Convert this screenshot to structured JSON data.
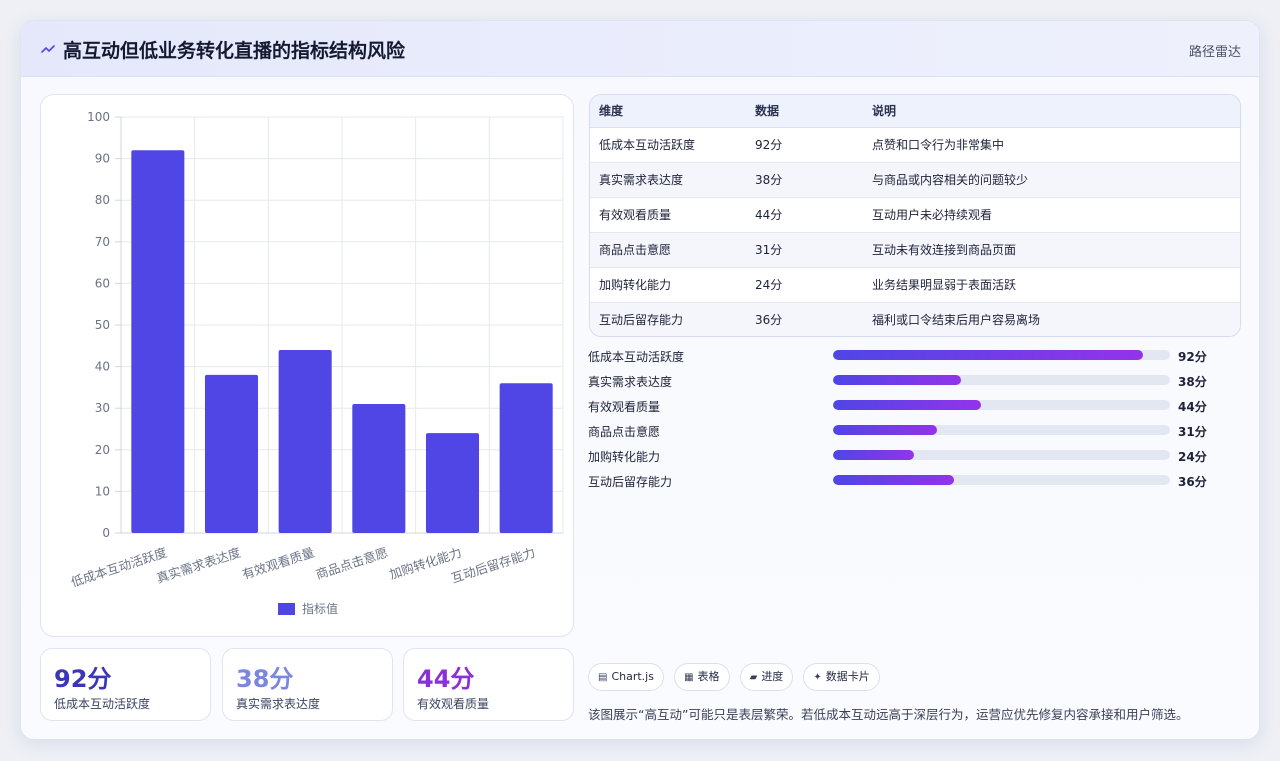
{
  "header": {
    "title": "高互动但低业务转化直播的指标结构风险",
    "tag": "路径雷达",
    "icon": "wave-icon"
  },
  "chart_data": {
    "type": "bar",
    "categories": [
      "低成本互动活跃度",
      "真实需求表达度",
      "有效观看质量",
      "商品点击意愿",
      "加购转化能力",
      "互动后留存能力"
    ],
    "series": [
      {
        "name": "指标值",
        "values": [
          92,
          38,
          44,
          31,
          24,
          36
        ],
        "color": "#4f46e5"
      }
    ],
    "ylim": [
      0,
      100
    ],
    "yticks": [
      0,
      10,
      20,
      30,
      40,
      50,
      60,
      70,
      80,
      90,
      100
    ],
    "grid": true,
    "legend": "bottom"
  },
  "table": {
    "headers": [
      "维度",
      "数据",
      "说明"
    ],
    "rows": [
      [
        "低成本互动活跃度",
        "92分",
        "点赞和口令行为非常集中"
      ],
      [
        "真实需求表达度",
        "38分",
        "与商品或内容相关的问题较少"
      ],
      [
        "有效观看质量",
        "44分",
        "互动用户未必持续观看"
      ],
      [
        "商品点击意愿",
        "31分",
        "互动未有效连接到商品页面"
      ],
      [
        "加购转化能力",
        "24分",
        "业务结果明显弱于表面活跃"
      ],
      [
        "互动后留存能力",
        "36分",
        "福利或口令结束后用户容易离场"
      ]
    ]
  },
  "progress": [
    {
      "label": "低成本互动活跃度",
      "value": 92,
      "display": "92分"
    },
    {
      "label": "真实需求表达度",
      "value": 38,
      "display": "38分"
    },
    {
      "label": "有效观看质量",
      "value": 44,
      "display": "44分"
    },
    {
      "label": "商品点击意愿",
      "value": 31,
      "display": "31分"
    },
    {
      "label": "加购转化能力",
      "value": 24,
      "display": "24分"
    },
    {
      "label": "互动后留存能力",
      "value": 36,
      "display": "36分"
    }
  ],
  "stats": [
    {
      "value": "92分",
      "label": "低成本互动活跃度",
      "color": "#3b35b8"
    },
    {
      "value": "38分",
      "label": "真实需求表达度",
      "color": "#7b86e0"
    },
    {
      "value": "44分",
      "label": "有效观看质量",
      "color": "#8b2fd6"
    }
  ],
  "pills": [
    {
      "icon": "chart-icon",
      "glyph": "▤",
      "label": "Chart.js"
    },
    {
      "icon": "table-icon",
      "glyph": "▦",
      "label": "表格"
    },
    {
      "icon": "progress-icon",
      "glyph": "▰",
      "label": "进度"
    },
    {
      "icon": "sparkle-icon",
      "glyph": "✦",
      "label": "数据卡片"
    }
  ],
  "footnote": "该图展示“高互动”可能只是表层繁荣。若低成本互动远高于深层行为，运营应优先修复内容承接和用户筛选。"
}
